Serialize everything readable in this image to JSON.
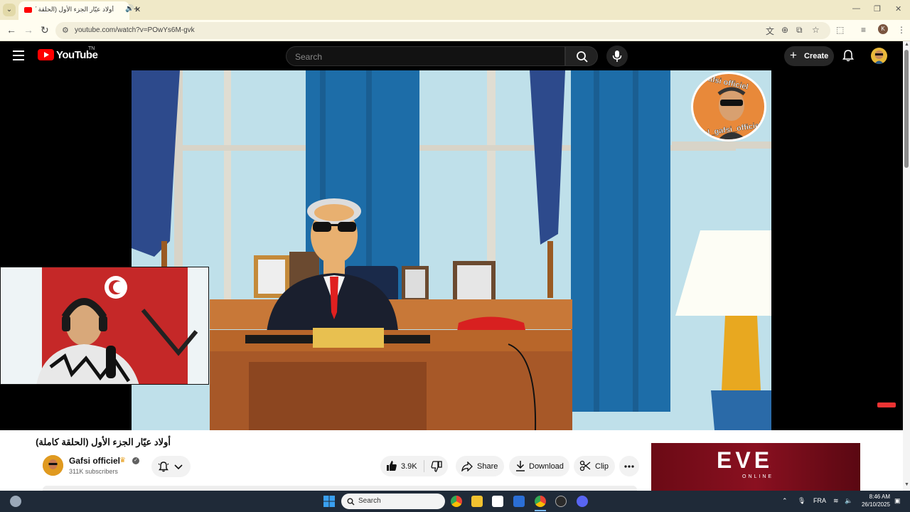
{
  "browser": {
    "tab_title": "أولاد عيّار الجزء الأول (الحلقة كاملة)",
    "url": "youtube.com/watch?v=POwYs6M-gvk"
  },
  "masthead": {
    "logo_text": "YouTube",
    "logo_suffix": "TN",
    "search_placeholder": "Search",
    "create_label": "Create"
  },
  "video": {
    "title": "أولاد عيّار الجزء الأول (الحلقة كاملة)",
    "watermark_top": "Gafsi officiel",
    "watermark_bottom": "el_gafsi_officiel"
  },
  "channel": {
    "name": "Gafsi officiel",
    "subscribers": "311K subscribers"
  },
  "actions": {
    "likes": "3.9K",
    "share": "Share",
    "download": "Download",
    "clip": "Clip"
  },
  "ad": {
    "brand": "EVE",
    "sub": "ONLINE"
  },
  "taskbar": {
    "search": "Search",
    "lang": "FRA",
    "time": "8:46 AM",
    "date": "26/10/2025"
  },
  "colors": {
    "youtube_red": "#ff0000",
    "browser_frame": "#f0e9c8",
    "ad_background": "#7a0c1a"
  }
}
